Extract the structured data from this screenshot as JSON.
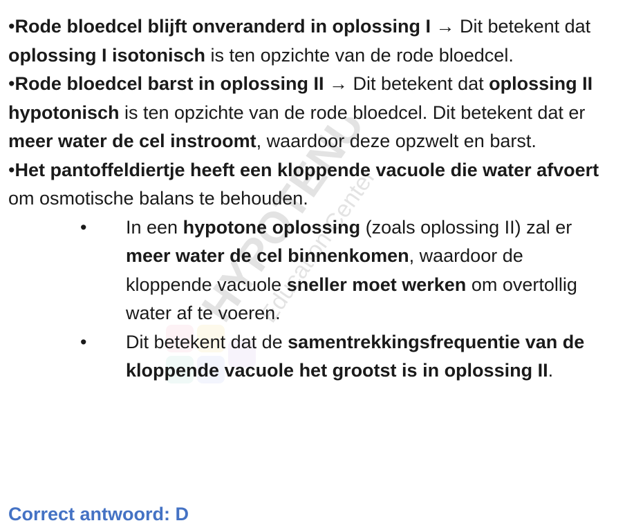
{
  "p1": {
    "bullet": "•",
    "b1": "Rode bloedcel blijft onveranderd in oplossing I",
    "t1": " → Dit betekent dat ",
    "b2": "oplossing I isotonisch",
    "t2": " is ten opzichte van de rode bloedcel."
  },
  "p2": {
    "bullet": "•",
    "b1": "Rode bloedcel barst in oplossing II",
    "t1": " → Dit betekent dat ",
    "b2": "oplossing II hypotonisch",
    "t2": " is ten opzichte van de rode bloedcel. Dit betekent dat er ",
    "b3": "meer water de cel instroomt",
    "t3": ", waardoor deze opzwelt en barst."
  },
  "p3": {
    "bullet": "•",
    "b1": "Het pantoffeldiertje heeft een kloppende vacuole die water afvoert",
    "t1": " om osmotische balans te behouden."
  },
  "sub1": {
    "bullet": "•",
    "t1": "In een ",
    "b1": "hypotone oplossing",
    "t2": " (zoals oplossing II) zal er ",
    "b2": "meer water de cel binnenkomen",
    "t3": ", waardoor de kloppende vacuole ",
    "b3": "sneller moet werken",
    "t4": " om overtollig water af te voeren."
  },
  "sub2": {
    "bullet": "•",
    "t1": "Dit betekent dat de ",
    "b1": "samentrekkingsfrequentie van de kloppende vacuole het grootst is in oplossing II",
    "t2": "."
  },
  "answer": "Correct antwoord: D",
  "watermark": {
    "title": "HYPOTENUSE",
    "subtitle": "Education Center"
  },
  "colors": {
    "answer": "#4472c4",
    "text": "#1a1a1a"
  }
}
